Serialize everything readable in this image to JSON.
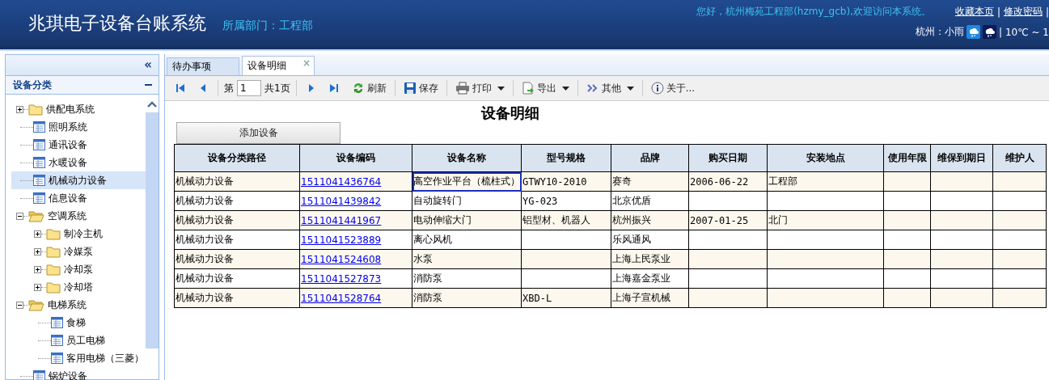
{
  "header": {
    "title": "兆琪电子设备台账系统",
    "department": "所属部门：工程部",
    "greeting": "您好，杭州梅苑工程部(hzmy_gcb),欢迎访问本系统。",
    "links": [
      {
        "label": "收藏本页"
      },
      {
        "label": "修改密码"
      }
    ],
    "link_separator": "|",
    "weather": {
      "city": "杭州：小雨",
      "temperature": "| 10℃ ~ 1"
    }
  },
  "sidebar": {
    "collapse_glyph": "«",
    "panel_title": "设备分类",
    "items": [
      {
        "kind": "folder",
        "label": "供配电系统",
        "expanded": false,
        "selected": false
      },
      {
        "kind": "file",
        "label": "照明系统",
        "selected": false
      },
      {
        "kind": "file",
        "label": "通讯设备",
        "selected": false
      },
      {
        "kind": "file",
        "label": "水暖设备",
        "selected": false
      },
      {
        "kind": "file",
        "label": "机械动力设备",
        "selected": true
      },
      {
        "kind": "file",
        "label": "信息设备",
        "selected": false
      },
      {
        "kind": "folder",
        "label": "空调系统",
        "expanded": true,
        "selected": false,
        "children": [
          {
            "kind": "folder",
            "label": "制冷主机",
            "expanded": false,
            "selected": false
          },
          {
            "kind": "folder",
            "label": "冷媒泵",
            "expanded": false,
            "selected": false
          },
          {
            "kind": "folder",
            "label": "冷却泵",
            "expanded": false,
            "selected": false
          },
          {
            "kind": "folder",
            "label": "冷却塔",
            "expanded": false,
            "selected": false
          }
        ]
      },
      {
        "kind": "folder",
        "label": "电梯系统",
        "expanded": true,
        "selected": false,
        "children": [
          {
            "kind": "file",
            "label": "食梯",
            "selected": false
          },
          {
            "kind": "file",
            "label": "员工电梯",
            "selected": false
          },
          {
            "kind": "file",
            "label": "客用电梯（三菱）",
            "selected": false
          }
        ]
      },
      {
        "kind": "file",
        "label": "锅炉设备",
        "selected": false
      }
    ]
  },
  "tabs": [
    {
      "label": "待办事项",
      "selected": false
    },
    {
      "label": "设备明细",
      "selected": true,
      "close": "×"
    }
  ],
  "toolbar": {
    "page_prefix": "第",
    "page": "1",
    "page_total": "共1页",
    "buttons": [
      {
        "kind": "refresh",
        "label": "刷新",
        "dropdown": false
      },
      {
        "kind": "save",
        "label": "保存",
        "dropdown": false
      },
      {
        "kind": "print",
        "label": "打印",
        "dropdown": true
      },
      {
        "kind": "export",
        "label": "导出",
        "dropdown": true
      },
      {
        "kind": "more",
        "label": "其他",
        "dropdown": true
      },
      {
        "kind": "info",
        "label": "关于...",
        "dropdown": false
      }
    ]
  },
  "content": {
    "title": "设备明细",
    "add_button": "添加设备",
    "table": {
      "columns": [
        "设备分类路径",
        "设备编码",
        "设备名称",
        "型号规格",
        "品牌",
        "购买日期",
        "安装地点",
        "使用年限",
        "维保到期日",
        "维护人"
      ],
      "rows": [
        {
          "path": "机械动力设备",
          "code": "1511041436764",
          "name": "高空作业平台（梳柱式）",
          "model": "GTWY10-2010",
          "brand": "赛奇",
          "purchase_date": "2006-06-22",
          "location": "工程部",
          "name_focused": true
        },
        {
          "path": "机械动力设备",
          "code": "1511041439842",
          "name": "自动旋转门",
          "model": "YG-023",
          "brand": "北京优盾",
          "name_focused": false
        },
        {
          "path": "机械动力设备",
          "code": "1511041441967",
          "name": "电动伸缩大门",
          "model": "铝型材、机器人",
          "brand": "杭州振兴",
          "purchase_date": "2007-01-25",
          "location": "北门",
          "name_focused": false
        },
        {
          "path": "机械动力设备",
          "code": "1511041523889",
          "name": "离心风机",
          "brand": "乐风通风",
          "name_focused": false
        },
        {
          "path": "机械动力设备",
          "code": "1511041524608",
          "name": "水泵",
          "brand": "上海上民泵业",
          "name_focused": false
        },
        {
          "path": "机械动力设备",
          "code": "1511041527873",
          "name": "消防泵",
          "brand": "上海嘉金泵业",
          "name_focused": false
        },
        {
          "path": "机械动力设备",
          "code": "1511041528764",
          "name": "消防泵",
          "model": "XBD-L",
          "brand": "上海子宣机械",
          "name_focused": false
        }
      ]
    }
  }
}
